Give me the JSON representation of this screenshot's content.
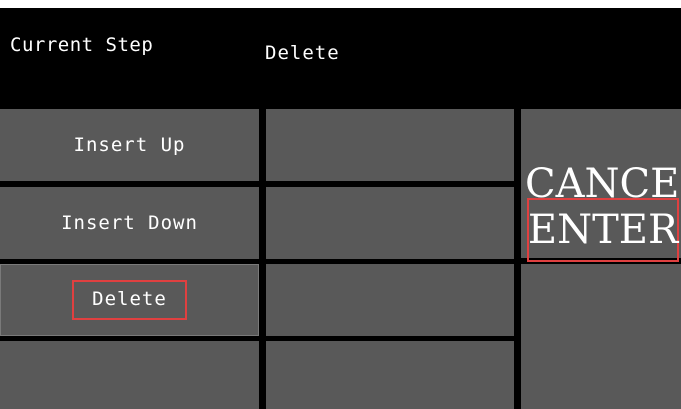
{
  "header": {
    "label": "Current Step",
    "value": "Delete"
  },
  "buttons": {
    "insert_up": "Insert Up",
    "insert_down": "Insert Down",
    "delete": "Delete",
    "cancel": "CANCEL",
    "enter": "ENTER"
  },
  "colors": {
    "background": "#000000",
    "button": "#595959",
    "highlight": "#e04040",
    "text": "#ffffff"
  }
}
